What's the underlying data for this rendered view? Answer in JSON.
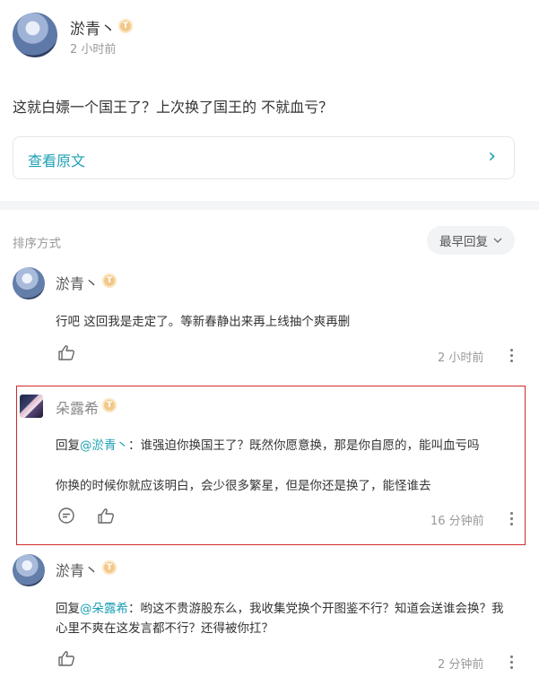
{
  "post": {
    "author": "淤青丶",
    "badge": "T",
    "time": "2 小时前",
    "content": "这就白嫖一个国王了？上次换了国王的 不就血亏？",
    "view_original": "查看原文",
    "chevron": "›"
  },
  "sort": {
    "label": "排序方式",
    "current": "最早回复"
  },
  "comments": [
    {
      "author": "淤青丶",
      "badge": "T",
      "text": "行吧 这回我是走定了。等新春静出来再上线抽个爽再删",
      "time": "2 小时前"
    },
    {
      "author": "朵露希",
      "badge": "T",
      "reply_prefix": "回复",
      "reply_target": "@淤青丶",
      "reply_sep": "：",
      "line1": "谁强迫你换国王了？既然你愿意换，那是你自愿的，能叫血亏吗",
      "line2": "你换的时候你就应该明白，会少很多繁星，但是你还是换了，能怪谁去",
      "time": "16 分钟前",
      "highlight_color": "#cc2b2b"
    },
    {
      "author": "淤青丶",
      "badge": "T",
      "reply_prefix": "回复",
      "reply_target": "@朵露希",
      "reply_sep": "：",
      "line1": "哟这不贵游股东么，我收集党换个开图鉴不行？知道会送谁会换？我",
      "line2": "心里不爽在这发言都不行？还得被你扛？",
      "time": "2 分钟前"
    }
  ],
  "colors": {
    "accent": "#1ea0b5",
    "badge": "#f2c98a",
    "divider": "#f4f5f7"
  }
}
